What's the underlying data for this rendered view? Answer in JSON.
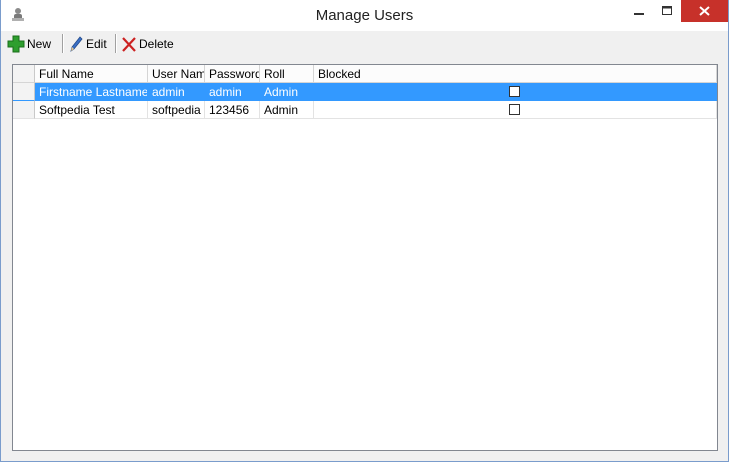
{
  "window": {
    "title": "Manage Users",
    "icon": "users-app-icon",
    "controls": [
      "minimize-icon",
      "maximize-icon",
      "close-icon"
    ]
  },
  "toolbar": {
    "new_label": "New",
    "edit_label": "Edit",
    "delete_label": "Delete"
  },
  "grid": {
    "columns": [
      "Full Name",
      "User Name",
      "Password",
      "Roll",
      "Blocked"
    ],
    "rows": [
      {
        "full_name": "Firstname Lastname",
        "user_name": "admin",
        "password": "admin",
        "roll": "Admin",
        "blocked": false,
        "selected": true
      },
      {
        "full_name": "Softpedia Test",
        "user_name": "softpedia",
        "password": "123456",
        "roll": "Admin",
        "blocked": false,
        "selected": false
      }
    ]
  },
  "colors": {
    "selection": "#3399ff",
    "close_button": "#c7312a",
    "new_icon": "#2e9e2e",
    "delete_icon": "#cc2222"
  }
}
